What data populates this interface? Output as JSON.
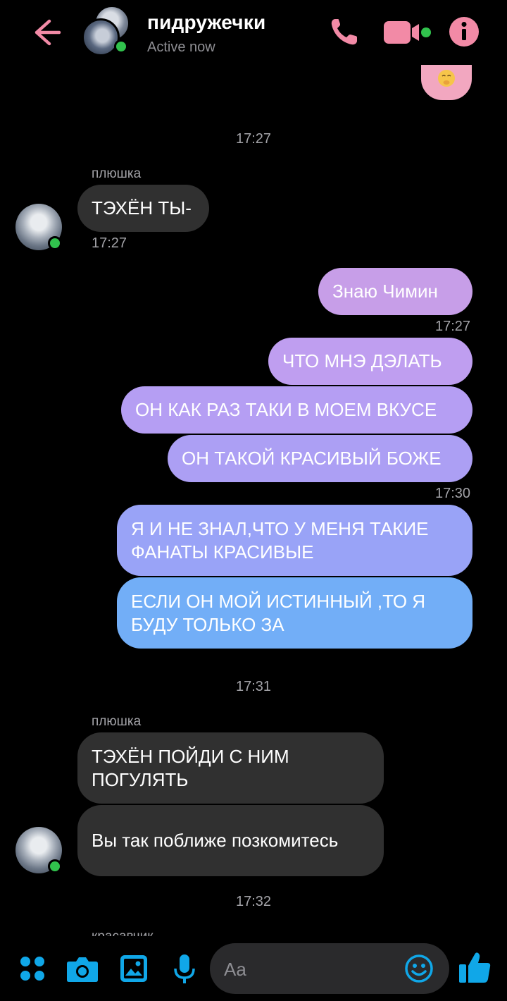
{
  "header": {
    "title": "пидружечки",
    "status": "Active now"
  },
  "messages": {
    "time_1": "17:27",
    "sender_1": "плюшка",
    "in_1": "ТЭХЁН ТЫ-",
    "in_1_time": "17:27",
    "out_1": "Знаю Чимин",
    "out_1_time": "17:27",
    "out_2": "ЧТО МНЭ ДЭЛАТЬ",
    "out_3": "ОН КАК РАЗ ТАКИ В МОЕМ ВКУСЕ",
    "out_4": "ОН ТАКОЙ КРАСИВЫЙ БОЖЕ",
    "out_4_time": "17:30",
    "out_5": "Я И НЕ ЗНАЛ,ЧТО У МЕНЯ ТАКИЕ ФАНАТЫ КРАСИВЫЕ",
    "out_6": "ЕСЛИ ОН МОЙ ИСТИННЫЙ ,ТО Я БУДУ ТОЛЬКО ЗА",
    "time_2": "17:31",
    "sender_2": "плюшка",
    "in_2": "ТЭХЁН ПОЙДИ С НИМ ПОГУЛЯТЬ",
    "in_3": "Вы так поближе позкомитесь",
    "time_3": "17:32",
    "sender_3": "красавчик"
  },
  "composer": {
    "placeholder": "Aa"
  },
  "colors": {
    "accent_pink": "#f28aa6",
    "accent_blue": "#10a7e8",
    "bubble_in": "#303030",
    "online": "#31c24d"
  }
}
